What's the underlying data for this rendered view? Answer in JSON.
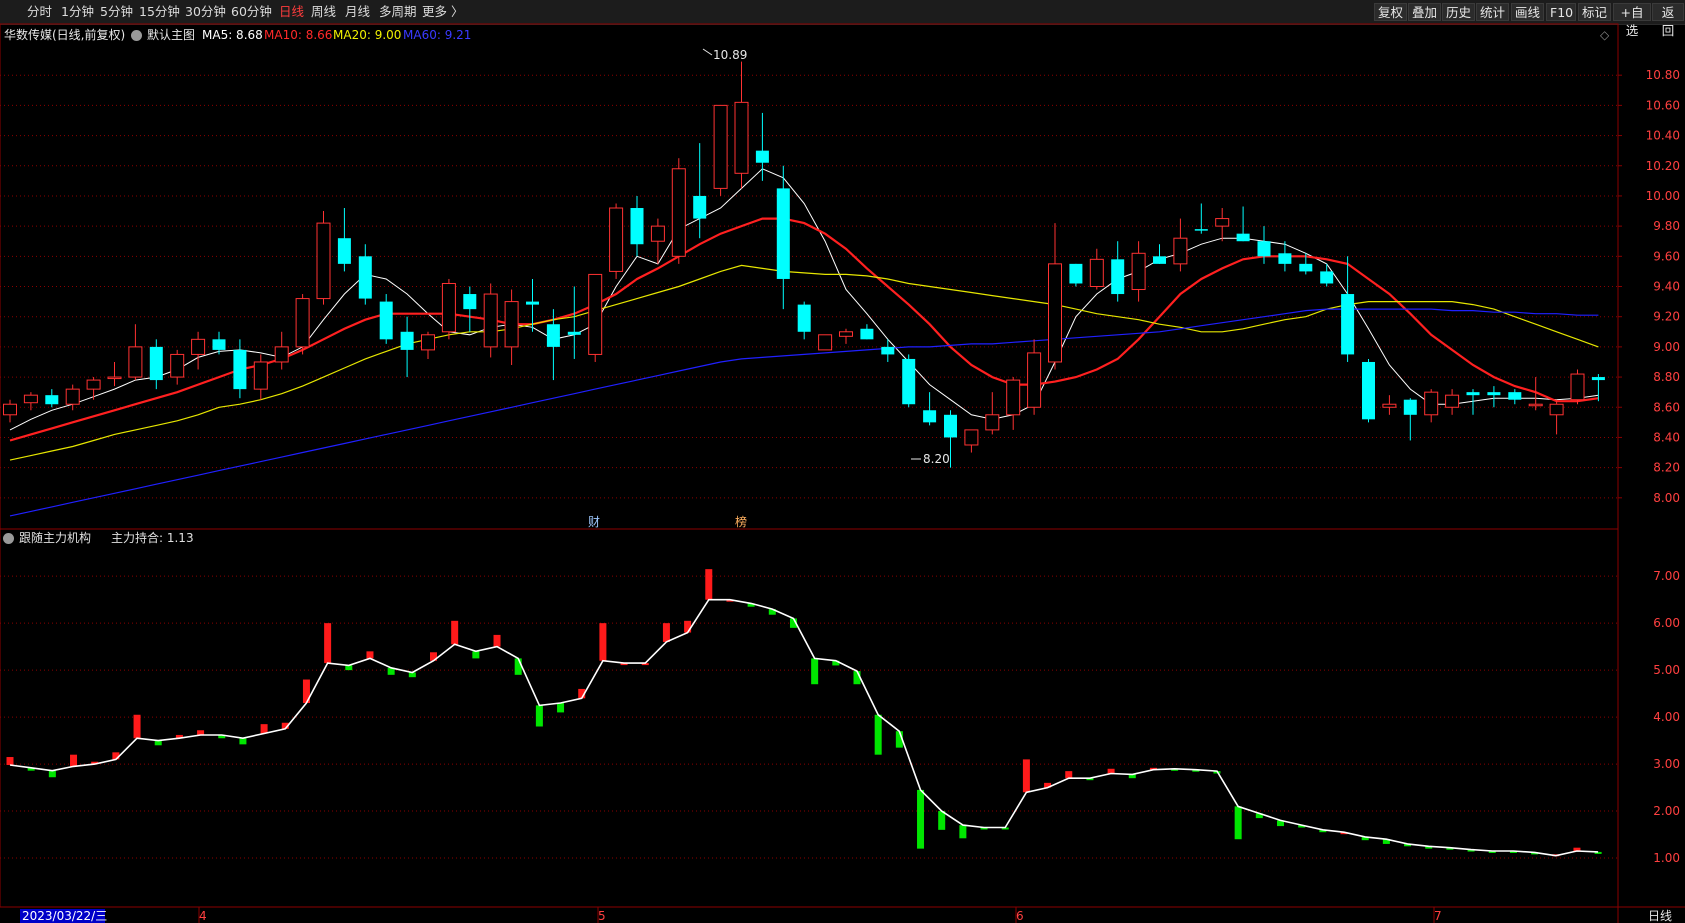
{
  "toolbar": {
    "periods": [
      "分时",
      "1分钟",
      "5分钟",
      "15分钟",
      "30分钟",
      "60分钟",
      "日线",
      "周线",
      "月线",
      "多周期",
      "更多 〉"
    ],
    "active_period": "日线",
    "right_buttons": [
      "复权",
      "叠加",
      "历史",
      "统计",
      "画线",
      "F10",
      "标记",
      "+自选",
      "返回"
    ]
  },
  "main_panel": {
    "stock_name": "华数传媒(日线,前复权)",
    "template": "默认主图",
    "ma5_label": "MA5: 8.68",
    "ma10_label": "MA10: 8.66",
    "ma20_label": "MA20: 9.00",
    "ma60_label": "MA60: 9.21",
    "high_marker": "10.89",
    "low_marker": "8.20",
    "event_markers": [
      "财",
      "榜"
    ]
  },
  "sub_panel": {
    "indicator_name": "跟随主力机构",
    "indicator_value": "主力持合: 1.13"
  },
  "x_axis": {
    "date_label": "2023/03/22/三",
    "month_labels": [
      "4",
      "5",
      "6",
      "7"
    ],
    "period_label": "日线"
  },
  "colors": {
    "up": "#ff3232",
    "down": "#00ffff",
    "ma5": "#ffffff",
    "ma10": "#ff2020",
    "ma20": "#e6e600",
    "ma60": "#2020ff",
    "grid": "#8b0000",
    "axis_text": "#ff4040",
    "sub_up": "#ff1a1a",
    "sub_down": "#00e600"
  },
  "chart_data": [
    {
      "type": "candlestick",
      "title": "华数传媒(日线,前复权)",
      "y_ticks": [
        8.0,
        8.2,
        8.4,
        8.6,
        8.8,
        9.0,
        9.2,
        9.4,
        9.6,
        9.8,
        10.0,
        10.2,
        10.4,
        10.6,
        10.8
      ],
      "ylim": [
        7.8,
        11.0
      ],
      "ohlc": [
        [
          8.55,
          8.65,
          8.5,
          8.62
        ],
        [
          8.63,
          8.7,
          8.58,
          8.68
        ],
        [
          8.68,
          8.72,
          8.6,
          8.62
        ],
        [
          8.62,
          8.75,
          8.58,
          8.72
        ],
        [
          8.72,
          8.8,
          8.65,
          8.78
        ],
        [
          8.8,
          8.9,
          8.74,
          8.8
        ],
        [
          8.8,
          9.15,
          8.78,
          9.0
        ],
        [
          9.0,
          9.05,
          8.72,
          8.78
        ],
        [
          8.8,
          8.98,
          8.75,
          8.95
        ],
        [
          8.95,
          9.1,
          8.85,
          9.05
        ],
        [
          9.05,
          9.1,
          8.95,
          8.98
        ],
        [
          8.98,
          9.05,
          8.66,
          8.72
        ],
        [
          8.72,
          8.95,
          8.65,
          8.9
        ],
        [
          8.9,
          9.1,
          8.85,
          9.0
        ],
        [
          9.0,
          9.35,
          8.95,
          9.32
        ],
        [
          9.32,
          9.9,
          9.28,
          9.82
        ],
        [
          9.72,
          9.92,
          9.5,
          9.55
        ],
        [
          9.6,
          9.68,
          9.28,
          9.32
        ],
        [
          9.3,
          9.35,
          9.02,
          9.05
        ],
        [
          9.1,
          9.2,
          8.8,
          8.98
        ],
        [
          8.98,
          9.1,
          8.92,
          9.08
        ],
        [
          9.1,
          9.45,
          9.05,
          9.42
        ],
        [
          9.35,
          9.4,
          9.1,
          9.25
        ],
        [
          9.0,
          9.42,
          8.93,
          9.35
        ],
        [
          9.0,
          9.38,
          8.88,
          9.3
        ],
        [
          9.3,
          9.45,
          9.1,
          9.28
        ],
        [
          9.15,
          9.25,
          8.78,
          9.0
        ],
        [
          9.1,
          9.4,
          8.92,
          9.08
        ],
        [
          8.95,
          9.45,
          8.9,
          9.48
        ],
        [
          9.5,
          9.95,
          9.45,
          9.92
        ],
        [
          9.92,
          10.0,
          9.6,
          9.68
        ],
        [
          9.7,
          9.85,
          9.55,
          9.8
        ],
        [
          9.6,
          10.25,
          9.55,
          10.18
        ],
        [
          10.0,
          10.35,
          9.72,
          9.85
        ],
        [
          10.05,
          10.58,
          10.0,
          10.6
        ],
        [
          10.15,
          10.89,
          10.05,
          10.62
        ],
        [
          10.3,
          10.55,
          10.1,
          10.22
        ],
        [
          10.05,
          10.2,
          9.25,
          9.45
        ],
        [
          9.28,
          9.3,
          9.05,
          9.1
        ],
        [
          8.98,
          9.08,
          8.98,
          9.08
        ],
        [
          9.07,
          9.12,
          9.02,
          9.1
        ],
        [
          9.12,
          9.15,
          9.05,
          9.05
        ],
        [
          9.0,
          9.05,
          8.9,
          8.95
        ],
        [
          8.92,
          8.95,
          8.6,
          8.62
        ],
        [
          8.58,
          8.7,
          8.48,
          8.5
        ],
        [
          8.55,
          8.58,
          8.2,
          8.4
        ],
        [
          8.35,
          8.45,
          8.3,
          8.45
        ],
        [
          8.45,
          8.7,
          8.42,
          8.55
        ],
        [
          8.55,
          8.8,
          8.45,
          8.78
        ],
        [
          8.6,
          9.05,
          8.55,
          8.96
        ],
        [
          8.9,
          9.82,
          8.85,
          9.55
        ],
        [
          9.55,
          9.55,
          9.4,
          9.42
        ],
        [
          9.4,
          9.65,
          9.38,
          9.58
        ],
        [
          9.58,
          9.7,
          9.3,
          9.35
        ],
        [
          9.38,
          9.7,
          9.3,
          9.62
        ],
        [
          9.6,
          9.68,
          9.55,
          9.55
        ],
        [
          9.55,
          9.85,
          9.5,
          9.72
        ],
        [
          9.78,
          9.95,
          9.75,
          9.77
        ],
        [
          9.8,
          9.92,
          9.7,
          9.85
        ],
        [
          9.75,
          9.93,
          9.7,
          9.7
        ],
        [
          9.7,
          9.8,
          9.55,
          9.6
        ],
        [
          9.62,
          9.7,
          9.5,
          9.55
        ],
        [
          9.55,
          9.62,
          9.48,
          9.5
        ],
        [
          9.5,
          9.55,
          9.4,
          9.42
        ],
        [
          9.35,
          9.6,
          8.9,
          8.95
        ],
        [
          8.9,
          8.92,
          8.5,
          8.52
        ],
        [
          8.6,
          8.68,
          8.55,
          8.62
        ],
        [
          8.65,
          8.66,
          8.38,
          8.55
        ],
        [
          8.55,
          8.72,
          8.5,
          8.7
        ],
        [
          8.6,
          8.72,
          8.55,
          8.68
        ],
        [
          8.7,
          8.72,
          8.55,
          8.68
        ],
        [
          8.7,
          8.74,
          8.6,
          8.68
        ],
        [
          8.7,
          8.72,
          8.62,
          8.65
        ],
        [
          8.62,
          8.8,
          8.58,
          8.62
        ],
        [
          8.55,
          8.65,
          8.42,
          8.62
        ],
        [
          8.65,
          8.85,
          8.62,
          8.82
        ],
        [
          8.8,
          8.82,
          8.64,
          8.78
        ]
      ],
      "series": [
        {
          "name": "MA5",
          "values": [
            8.45,
            8.52,
            8.58,
            8.62,
            8.67,
            8.72,
            8.78,
            8.8,
            8.85,
            8.93,
            8.97,
            8.98,
            8.96,
            8.93,
            9.0,
            9.18,
            9.35,
            9.48,
            9.45,
            9.35,
            9.22,
            9.1,
            9.08,
            9.13,
            9.15,
            9.13,
            9.05,
            9.08,
            9.15,
            9.4,
            9.6,
            9.55,
            9.78,
            9.85,
            9.92,
            10.05,
            10.18,
            10.12,
            9.95,
            9.7,
            9.38,
            9.22,
            9.05,
            8.9,
            8.75,
            8.65,
            8.55,
            8.52,
            8.55,
            8.62,
            8.9,
            9.2,
            9.35,
            9.45,
            9.5,
            9.58,
            9.62,
            9.68,
            9.72,
            9.72,
            9.7,
            9.68,
            9.62,
            9.55,
            9.35,
            9.12,
            8.88,
            8.72,
            8.62,
            8.62,
            8.64,
            8.66,
            8.66,
            8.66,
            8.65,
            8.66,
            8.68
          ]
        },
        {
          "name": "MA10",
          "values": [
            8.38,
            8.42,
            8.46,
            8.5,
            8.54,
            8.58,
            8.62,
            8.66,
            8.7,
            8.75,
            8.8,
            8.85,
            8.88,
            8.92,
            8.98,
            9.05,
            9.12,
            9.18,
            9.22,
            9.22,
            9.22,
            9.22,
            9.2,
            9.18,
            9.15,
            9.15,
            9.18,
            9.22,
            9.28,
            9.35,
            9.45,
            9.52,
            9.6,
            9.68,
            9.75,
            9.8,
            9.85,
            9.85,
            9.82,
            9.75,
            9.65,
            9.52,
            9.4,
            9.28,
            9.15,
            9.0,
            8.88,
            8.8,
            8.75,
            8.75,
            8.77,
            8.8,
            8.85,
            8.92,
            9.05,
            9.2,
            9.35,
            9.45,
            9.52,
            9.58,
            9.6,
            9.6,
            9.6,
            9.58,
            9.55,
            9.45,
            9.35,
            9.22,
            9.08,
            8.98,
            8.88,
            8.8,
            8.74,
            8.7,
            8.64,
            8.64,
            8.66
          ]
        },
        {
          "name": "MA20",
          "values": [
            8.25,
            8.28,
            8.31,
            8.34,
            8.38,
            8.42,
            8.45,
            8.48,
            8.51,
            8.55,
            8.6,
            8.62,
            8.65,
            8.69,
            8.74,
            8.8,
            8.86,
            8.92,
            8.97,
            9.02,
            9.05,
            9.08,
            9.1,
            9.1,
            9.12,
            9.15,
            9.18,
            9.2,
            9.24,
            9.28,
            9.32,
            9.36,
            9.4,
            9.45,
            9.5,
            9.54,
            9.52,
            9.5,
            9.49,
            9.48,
            9.48,
            9.47,
            9.45,
            9.42,
            9.4,
            9.38,
            9.36,
            9.34,
            9.32,
            9.3,
            9.28,
            9.25,
            9.22,
            9.2,
            9.18,
            9.15,
            9.13,
            9.1,
            9.1,
            9.12,
            9.15,
            9.18,
            9.2,
            9.25,
            9.28,
            9.3,
            9.3,
            9.3,
            9.3,
            9.3,
            9.28,
            9.25,
            9.2,
            9.15,
            9.1,
            9.05,
            9.0
          ]
        },
        {
          "name": "MA60",
          "values": [
            7.88,
            7.91,
            7.94,
            7.97,
            8.0,
            8.03,
            8.06,
            8.09,
            8.12,
            8.15,
            8.18,
            8.21,
            8.24,
            8.27,
            8.3,
            8.33,
            8.36,
            8.39,
            8.42,
            8.45,
            8.48,
            8.51,
            8.54,
            8.57,
            8.6,
            8.63,
            8.66,
            8.69,
            8.72,
            8.75,
            8.78,
            8.81,
            8.84,
            8.87,
            8.9,
            8.92,
            8.93,
            8.94,
            8.95,
            8.96,
            8.97,
            8.98,
            8.99,
            9.0,
            9.0,
            9.01,
            9.02,
            9.02,
            9.03,
            9.04,
            9.05,
            9.06,
            9.07,
            9.08,
            9.09,
            9.1,
            9.12,
            9.14,
            9.16,
            9.18,
            9.2,
            9.22,
            9.24,
            9.25,
            9.25,
            9.25,
            9.25,
            9.25,
            9.25,
            9.24,
            9.24,
            9.23,
            9.23,
            9.22,
            9.22,
            9.21,
            9.21
          ]
        }
      ]
    },
    {
      "type": "bar",
      "title": "跟随主力机构",
      "y_ticks": [
        1.0,
        2.0,
        3.0,
        4.0,
        5.0,
        6.0,
        7.0
      ],
      "ylim": [
        0.0,
        7.6
      ],
      "bars": [
        [
          2.98,
          3.15
        ],
        [
          2.92,
          2.86
        ],
        [
          2.86,
          2.72
        ],
        [
          2.95,
          3.2
        ],
        [
          3.0,
          3.05
        ],
        [
          3.1,
          3.25
        ],
        [
          3.55,
          4.05
        ],
        [
          3.5,
          3.4
        ],
        [
          3.55,
          3.62
        ],
        [
          3.62,
          3.72
        ],
        [
          3.62,
          3.55
        ],
        [
          3.55,
          3.42
        ],
        [
          3.65,
          3.85
        ],
        [
          3.75,
          3.88
        ],
        [
          4.3,
          4.8
        ],
        [
          5.15,
          6.0
        ],
        [
          5.1,
          5.0
        ],
        [
          5.25,
          5.4
        ],
        [
          5.05,
          4.9
        ],
        [
          4.95,
          4.85
        ],
        [
          5.2,
          5.38
        ],
        [
          5.55,
          6.05
        ],
        [
          5.4,
          5.25
        ],
        [
          5.5,
          5.75
        ],
        [
          5.25,
          4.9
        ],
        [
          4.25,
          3.8
        ],
        [
          4.3,
          4.1
        ],
        [
          4.4,
          4.6
        ],
        [
          5.2,
          6.0
        ],
        [
          5.15,
          5.15
        ],
        [
          5.15,
          5.15
        ],
        [
          5.6,
          6.0
        ],
        [
          5.8,
          6.05
        ],
        [
          6.5,
          7.15
        ],
        [
          6.5,
          6.5
        ],
        [
          6.42,
          6.35
        ],
        [
          6.3,
          6.18
        ],
        [
          6.1,
          5.9
        ],
        [
          5.25,
          4.7
        ],
        [
          5.2,
          5.1
        ],
        [
          4.98,
          4.7
        ],
        [
          4.05,
          3.2
        ],
        [
          3.7,
          3.35
        ],
        [
          2.45,
          1.2
        ],
        [
          2.0,
          1.6
        ],
        [
          1.7,
          1.42
        ],
        [
          1.65,
          1.62
        ],
        [
          1.65,
          1.62
        ],
        [
          2.4,
          3.1
        ],
        [
          2.5,
          2.6
        ],
        [
          2.7,
          2.85
        ],
        [
          2.7,
          2.68
        ],
        [
          2.8,
          2.9
        ],
        [
          2.78,
          2.7
        ],
        [
          2.88,
          2.92
        ],
        [
          2.9,
          2.88
        ],
        [
          2.88,
          2.85
        ],
        [
          2.85,
          2.8
        ],
        [
          2.1,
          1.4
        ],
        [
          1.95,
          1.85
        ],
        [
          1.8,
          1.68
        ],
        [
          1.7,
          1.65
        ],
        [
          1.6,
          1.55
        ],
        [
          1.55,
          1.55
        ],
        [
          1.45,
          1.38
        ],
        [
          1.4,
          1.3
        ],
        [
          1.3,
          1.25
        ],
        [
          1.25,
          1.2
        ],
        [
          1.22,
          1.2
        ],
        [
          1.18,
          1.14
        ],
        [
          1.15,
          1.12
        ],
        [
          1.15,
          1.12
        ],
        [
          1.12,
          1.1
        ],
        [
          1.05,
          1.08
        ],
        [
          1.15,
          1.22
        ],
        [
          1.13,
          1.1
        ]
      ]
    }
  ]
}
